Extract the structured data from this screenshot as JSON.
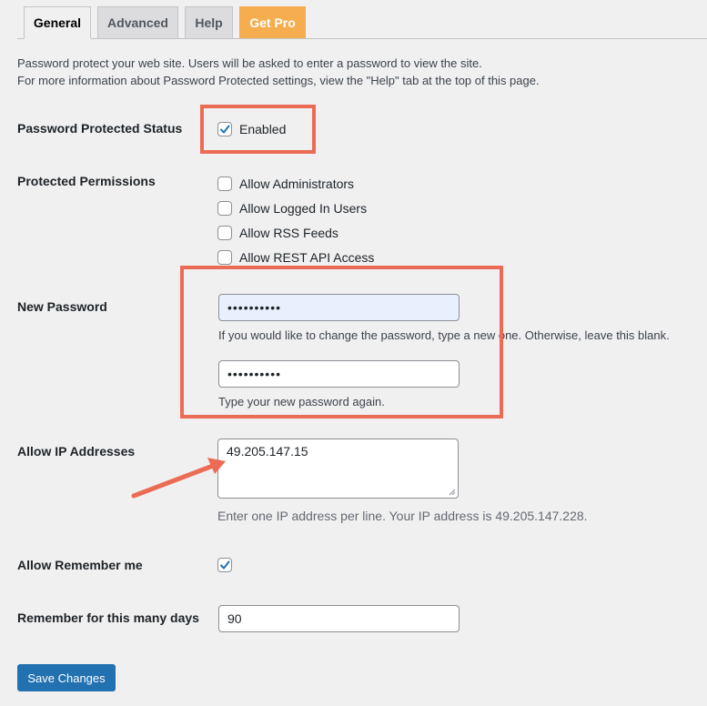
{
  "tabs": [
    {
      "label": "General"
    },
    {
      "label": "Advanced"
    },
    {
      "label": "Help"
    },
    {
      "label": "Get Pro"
    }
  ],
  "intro": {
    "line1": "Password protect your web site. Users will be asked to enter a password to view the site.",
    "line2": "For more information about Password Protected settings, view the \"Help\" tab at the top of this page."
  },
  "status": {
    "label": "Password Protected Status",
    "enabled_label": "Enabled",
    "enabled_checked": true
  },
  "permissions": {
    "label": "Protected Permissions",
    "options": [
      {
        "label": "Allow Administrators",
        "checked": false
      },
      {
        "label": "Allow Logged In Users",
        "checked": false
      },
      {
        "label": "Allow RSS Feeds",
        "checked": false
      },
      {
        "label": "Allow REST API Access",
        "checked": false
      }
    ]
  },
  "new_password": {
    "label": "New Password",
    "value1": "••••••••••",
    "hint1": "If you would like to change the password, type a new one. Otherwise, leave this blank.",
    "value2": "••••••••••",
    "hint2": "Type your new password again."
  },
  "ip": {
    "label": "Allow IP Addresses",
    "value": "49.205.147.15",
    "hint": "Enter one IP address per line. Your IP address is 49.205.147.228."
  },
  "remember": {
    "label": "Allow Remember me",
    "checked": true
  },
  "remember_days": {
    "label": "Remember for this many days",
    "value": "90"
  },
  "save_label": "Save Changes",
  "colors": {
    "annotation": "#ec6b55",
    "accent": "#2271b1",
    "pro": "#f6ad4f"
  }
}
